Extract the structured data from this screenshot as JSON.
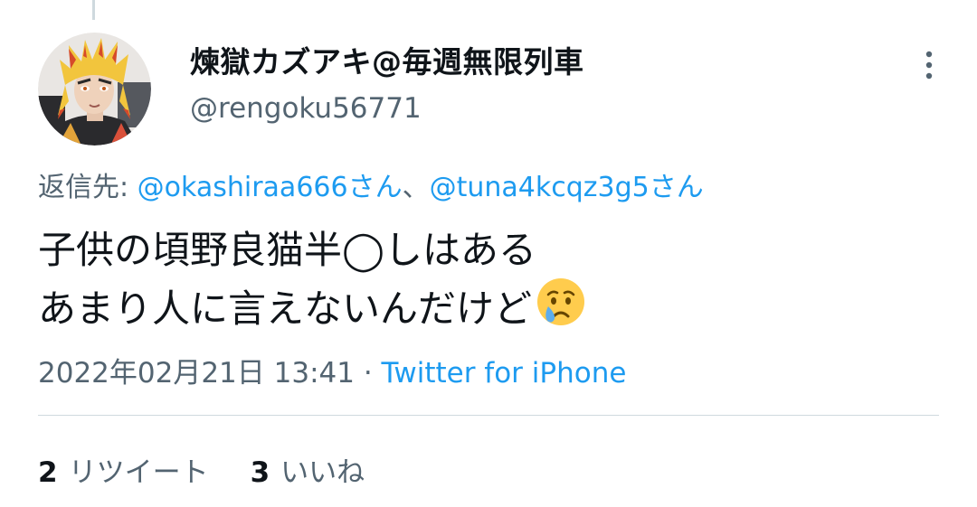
{
  "user": {
    "display_name": "煉獄カズアキ@毎週無限列車",
    "handle": "@rengoku56771",
    "avatar": "profile-photo"
  },
  "reply": {
    "prefix": "返信先: ",
    "mention_1": "@okashiraa666さん",
    "separator": "、",
    "mention_2": "@tuna4kcqz3g5さん"
  },
  "tweet": {
    "line_1": "子供の頃野良猫半◯しはある",
    "line_2": "あまり人に言えないんだけど",
    "emoji": "crying-face-icon"
  },
  "meta": {
    "timestamp": "2022年02月21日 13:41",
    "separator": " · ",
    "source": "Twitter for iPhone"
  },
  "stats": {
    "retweets_count": "2",
    "retweets_label": "リツイート",
    "likes_count": "3",
    "likes_label": "いいね"
  },
  "colors": {
    "link": "#1d9bf0",
    "secondary_text": "#536471",
    "primary_text": "#0f1419",
    "divider": "#cfd9de"
  }
}
